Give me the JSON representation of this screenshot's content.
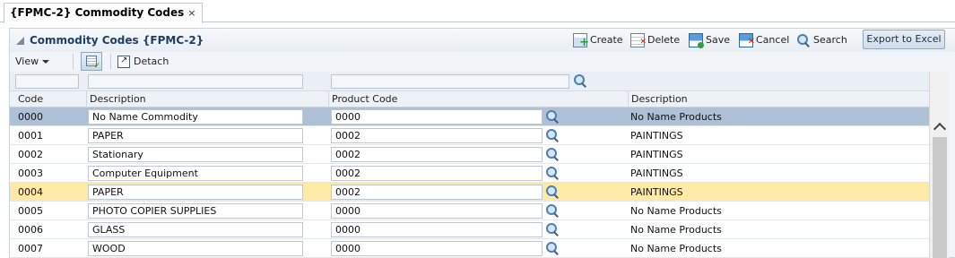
{
  "tab": {
    "label": "{FPMC-2} Commodity Codes",
    "close": "×"
  },
  "panel": {
    "title": "Commodity Codes {FPMC-2}"
  },
  "toolbar": {
    "create": "Create",
    "delete": "Delete",
    "save": "Save",
    "cancel": "Cancel",
    "search": "Search",
    "export": "Export to Excel"
  },
  "toolbar2": {
    "view": "View",
    "detach": "Detach"
  },
  "columns": {
    "code": "Code",
    "description": "Description",
    "product_code": "Product Code",
    "product_description": "Description"
  },
  "rows": [
    {
      "code": "0000",
      "description": "No Name Commodity",
      "product_code": "0000",
      "product_description": "No Name Products"
    },
    {
      "code": "0001",
      "description": "PAPER",
      "product_code": "0002",
      "product_description": "PAINTINGS"
    },
    {
      "code": "0002",
      "description": "Stationary",
      "product_code": "0002",
      "product_description": "PAINTINGS"
    },
    {
      "code": "0003",
      "description": "Computer Equipment",
      "product_code": "0002",
      "product_description": "PAINTINGS"
    },
    {
      "code": "0004",
      "description": "PAPER",
      "product_code": "0002",
      "product_description": "PAINTINGS"
    },
    {
      "code": "0005",
      "description": "PHOTO COPIER SUPPLIES",
      "product_code": "0000",
      "product_description": "No Name Products"
    },
    {
      "code": "0006",
      "description": "GLASS",
      "product_code": "0000",
      "product_description": "No Name Products"
    },
    {
      "code": "0007",
      "description": "WOOD",
      "product_code": "0000",
      "product_description": "No Name Products"
    }
  ],
  "colors": {
    "selected_row": "#aec0d5",
    "hover_row": "#fdeaa7",
    "title": "#1f3e66"
  }
}
